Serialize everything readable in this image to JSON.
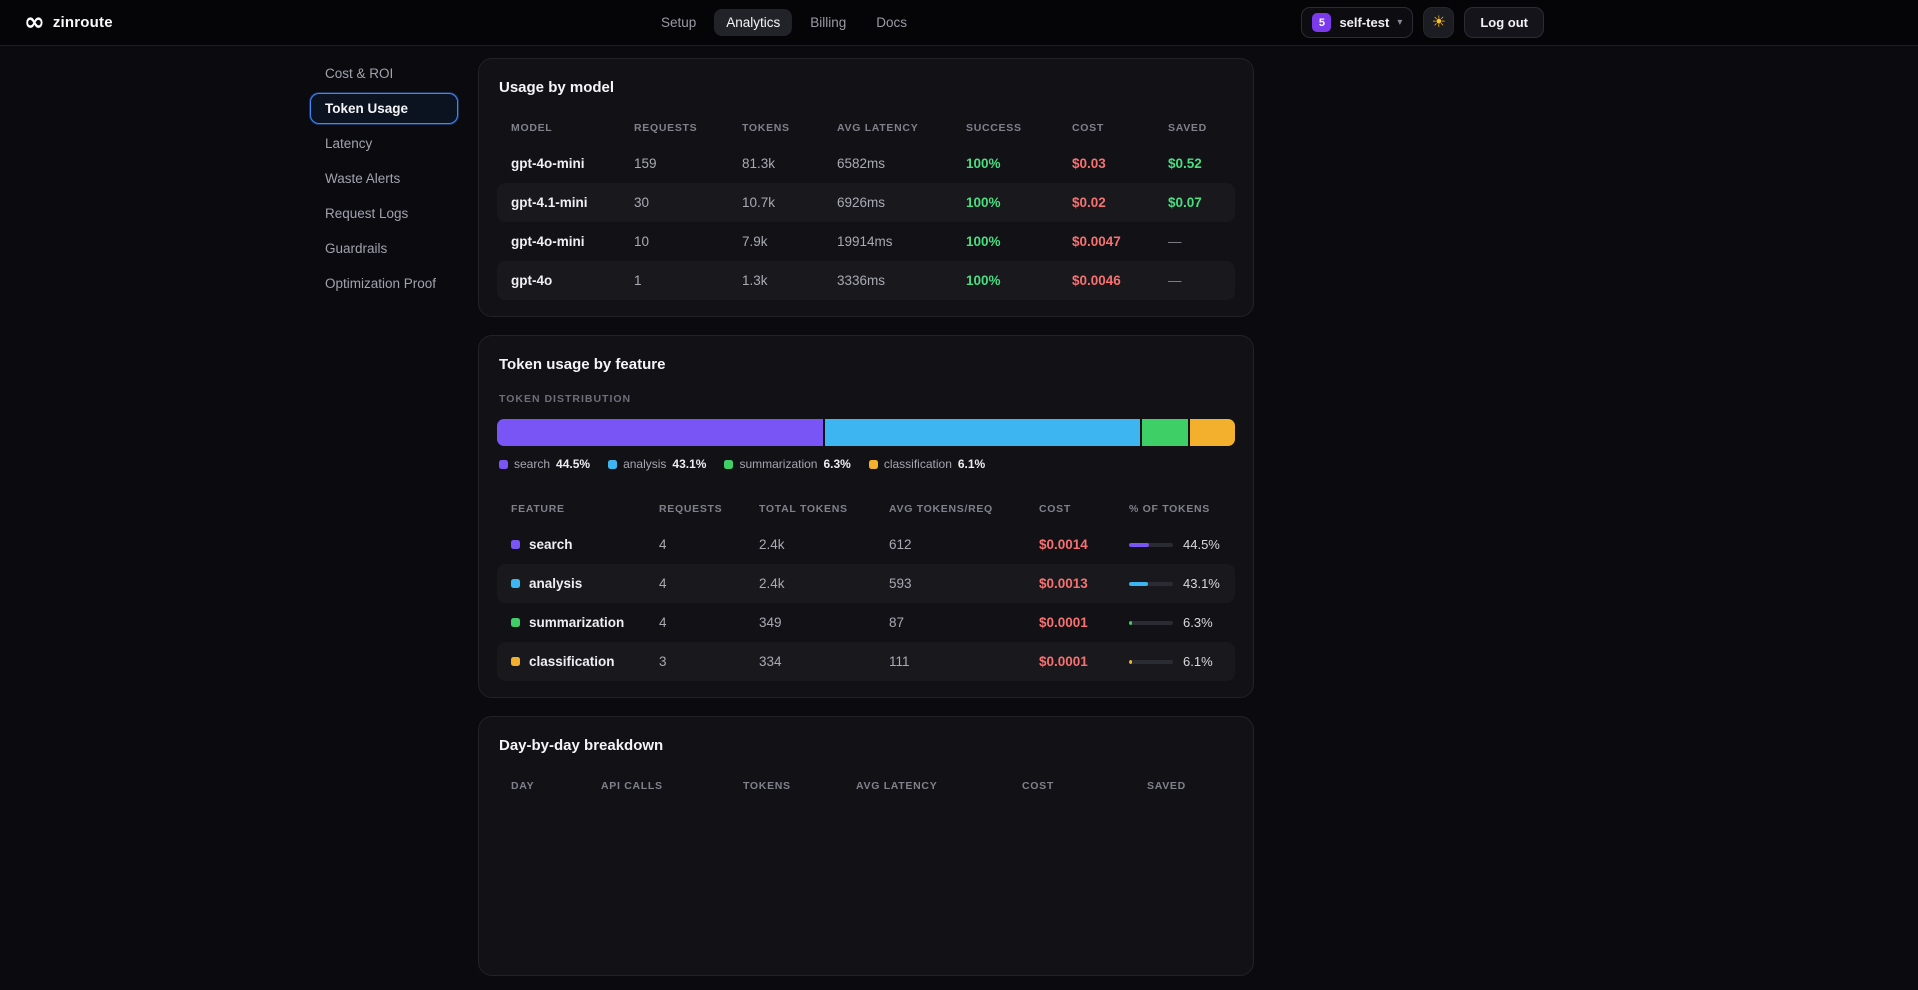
{
  "brand": {
    "name": "zinroute",
    "logo_icon": "infinity-logo"
  },
  "topnav": {
    "items": [
      {
        "label": "Setup",
        "active": false
      },
      {
        "label": "Analytics",
        "active": true
      },
      {
        "label": "Billing",
        "active": false
      },
      {
        "label": "Docs",
        "active": false
      }
    ]
  },
  "account": {
    "project_badge": "5",
    "project_name": "self-test",
    "chevron_icon": "chevron-down",
    "theme_icon": "sun",
    "logout_label": "Log out"
  },
  "sidebar": {
    "items": [
      {
        "label": "Cost & ROI",
        "active": false
      },
      {
        "label": "Token Usage",
        "active": true
      },
      {
        "label": "Latency",
        "active": false
      },
      {
        "label": "Waste Alerts",
        "active": false
      },
      {
        "label": "Request Logs",
        "active": false
      },
      {
        "label": "Guardrails",
        "active": false
      },
      {
        "label": "Optimization Proof",
        "active": false
      }
    ]
  },
  "usage_by_model": {
    "title": "Usage by model",
    "columns": [
      "MODEL",
      "REQUESTS",
      "TOKENS",
      "AVG LATENCY",
      "SUCCESS",
      "COST",
      "SAVED"
    ],
    "rows": [
      {
        "model": "gpt-4o-mini",
        "requests": "159",
        "tokens": "81.3k",
        "avg_latency": "6582ms",
        "success": "100%",
        "cost": "$0.03",
        "saved": "$0.52"
      },
      {
        "model": "gpt-4.1-mini",
        "requests": "30",
        "tokens": "10.7k",
        "avg_latency": "6926ms",
        "success": "100%",
        "cost": "$0.02",
        "saved": "$0.07"
      },
      {
        "model": "gpt-4o-mini",
        "requests": "10",
        "tokens": "7.9k",
        "avg_latency": "19914ms",
        "success": "100%",
        "cost": "$0.0047",
        "saved": "—"
      },
      {
        "model": "gpt-4o",
        "requests": "1",
        "tokens": "1.3k",
        "avg_latency": "3336ms",
        "success": "100%",
        "cost": "$0.0046",
        "saved": "—"
      }
    ]
  },
  "token_by_feature": {
    "title": "Token usage by feature",
    "distribution_label": "TOKEN DISTRIBUTION",
    "columns": [
      "FEATURE",
      "REQUESTS",
      "TOTAL TOKENS",
      "AVG TOKENS/REQ",
      "COST",
      "% OF TOKENS"
    ],
    "features": [
      {
        "name": "search",
        "color": "#7a55f6",
        "requests": "4",
        "total_tokens": "2.4k",
        "avg_tokens_req": "612",
        "cost": "$0.0014",
        "pct": "44.5%",
        "pct_value": 44.5
      },
      {
        "name": "analysis",
        "color": "#3db5f1",
        "requests": "4",
        "total_tokens": "2.4k",
        "avg_tokens_req": "593",
        "cost": "$0.0013",
        "pct": "43.1%",
        "pct_value": 43.1
      },
      {
        "name": "summarization",
        "color": "#3ecf66",
        "requests": "4",
        "total_tokens": "349",
        "avg_tokens_req": "87",
        "cost": "$0.0001",
        "pct": "6.3%",
        "pct_value": 6.3
      },
      {
        "name": "classification",
        "color": "#f3b02c",
        "requests": "3",
        "total_tokens": "334",
        "avg_tokens_req": "111",
        "cost": "$0.0001",
        "pct": "6.1%",
        "pct_value": 6.1
      }
    ]
  },
  "day_breakdown": {
    "title": "Day-by-day breakdown",
    "columns": [
      "DAY",
      "API CALLS",
      "TOKENS",
      "AVG LATENCY",
      "COST",
      "SAVED"
    ]
  }
}
